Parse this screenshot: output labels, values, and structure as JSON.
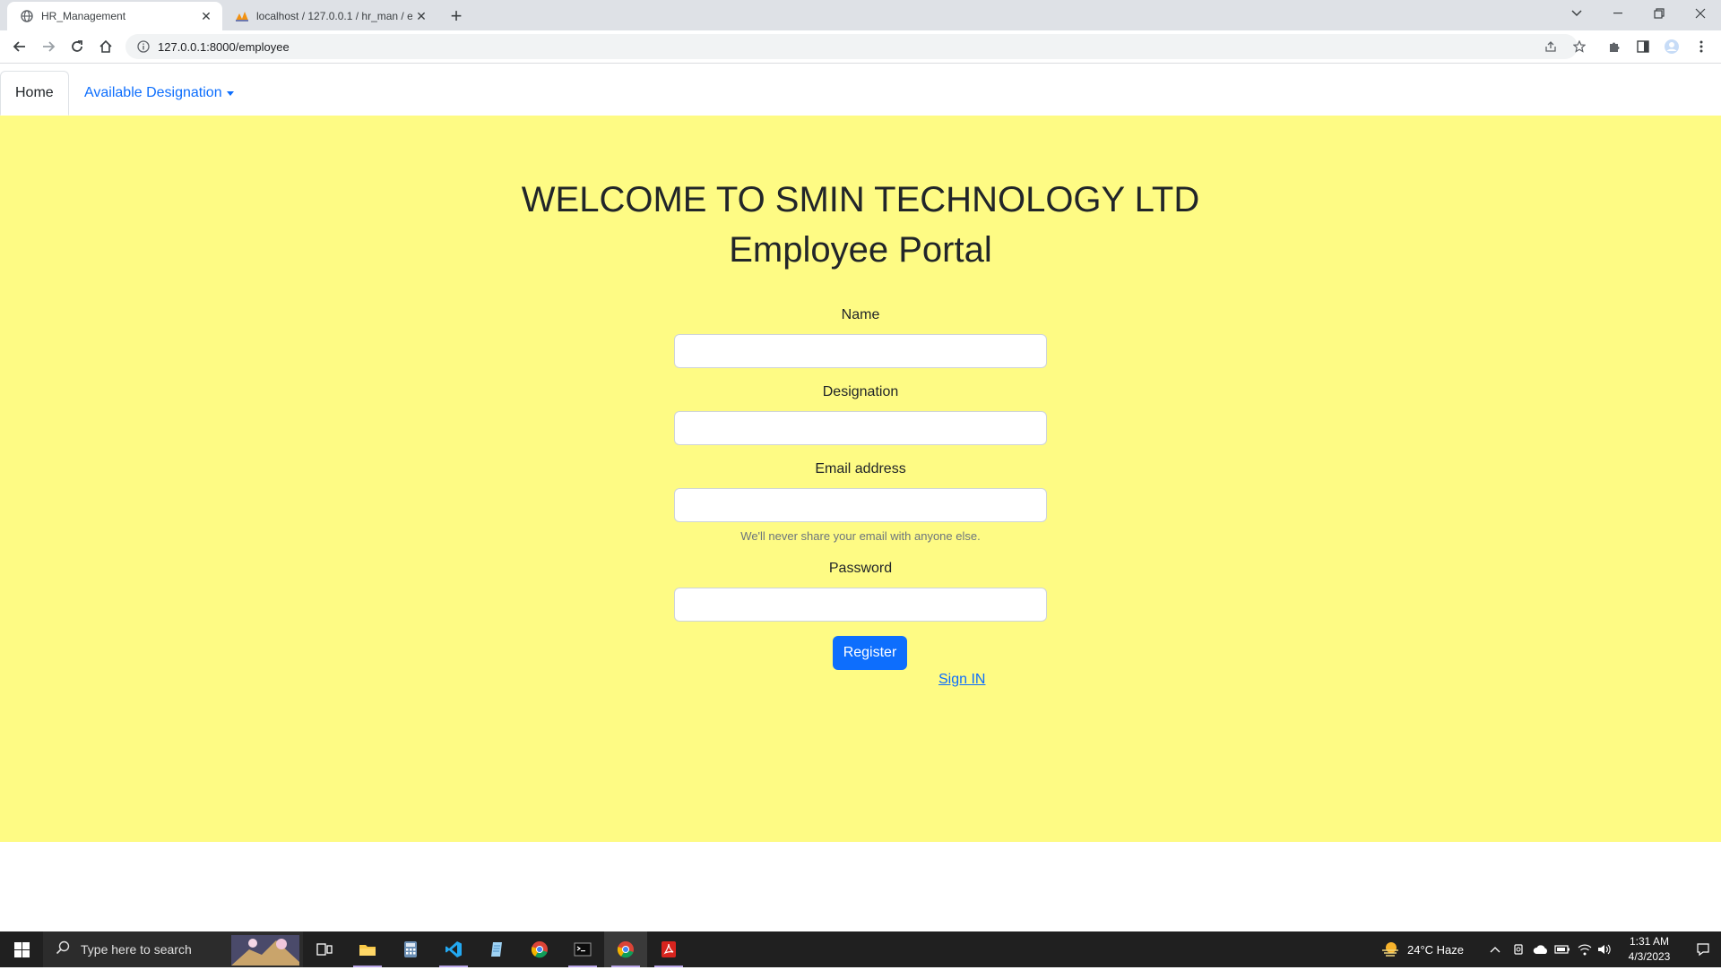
{
  "browser": {
    "tabs": [
      {
        "title": "HR_Management",
        "active": true,
        "favicon": "globe-icon"
      },
      {
        "title": "localhost / 127.0.0.1 / hr_man / e",
        "active": false,
        "favicon": "phpmyadmin-icon"
      }
    ],
    "url": "127.0.0.1:8000/employee"
  },
  "nav": {
    "home": "Home",
    "designation": "Available Designation"
  },
  "header": {
    "line1": "WELCOME TO SMIN TECHNOLOGY LTD",
    "line2": "Employee Portal"
  },
  "form": {
    "name_label": "Name",
    "designation_label": "Designation",
    "email_label": "Email address",
    "email_help": "We'll never share your email with anyone else.",
    "password_label": "Password",
    "register_label": "Register",
    "signin_label": "Sign IN"
  },
  "colors": {
    "page_background": "#fefb84",
    "primary": "#0d6efd"
  },
  "taskbar": {
    "search_placeholder": "Type here to search",
    "weather": "24°C  Haze",
    "time": "1:31 AM",
    "date": "4/3/2023"
  }
}
